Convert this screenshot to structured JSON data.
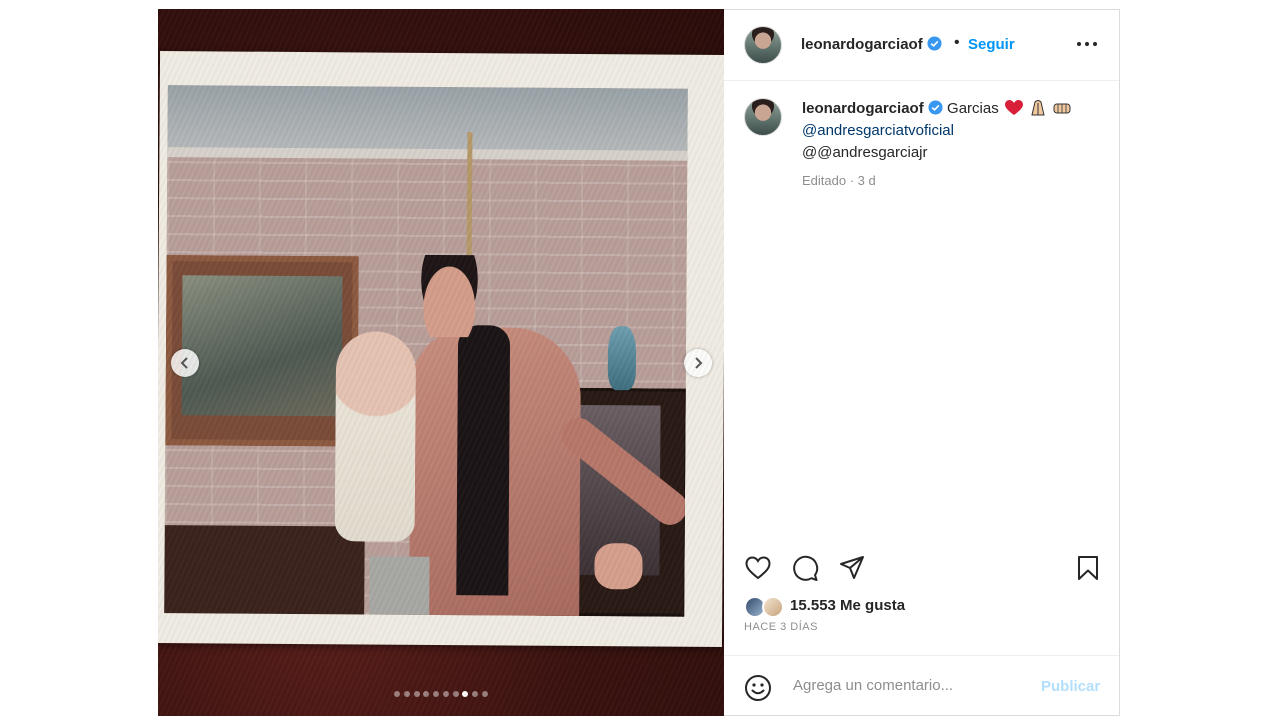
{
  "post": {
    "username": "leonardogarciaof",
    "follow_label": "Seguir",
    "separator": "•",
    "caption_text": "Garcias",
    "mention_1": "@andresgarciatvoficial",
    "mention_2": "@@andresgarciajr",
    "meta": "Editado · 3 d",
    "likes": "15.553 Me gusta",
    "time_ago": "HACE 3 DÍAS"
  },
  "carousel": {
    "total_slides": 10,
    "active_index": 7
  },
  "comment": {
    "placeholder": "Agrega un comentario...",
    "publish_label": "Publicar"
  },
  "colors": {
    "accent": "#0095f6",
    "publish_disabled": "#b2dffc",
    "mention": "#00376b",
    "verified": "#3897f0"
  },
  "icons": [
    "verified-badge-icon",
    "more-options-icon",
    "heart-icon",
    "comment-icon",
    "share-icon",
    "bookmark-icon",
    "smiley-icon",
    "chevron-left-icon",
    "chevron-right-icon"
  ]
}
